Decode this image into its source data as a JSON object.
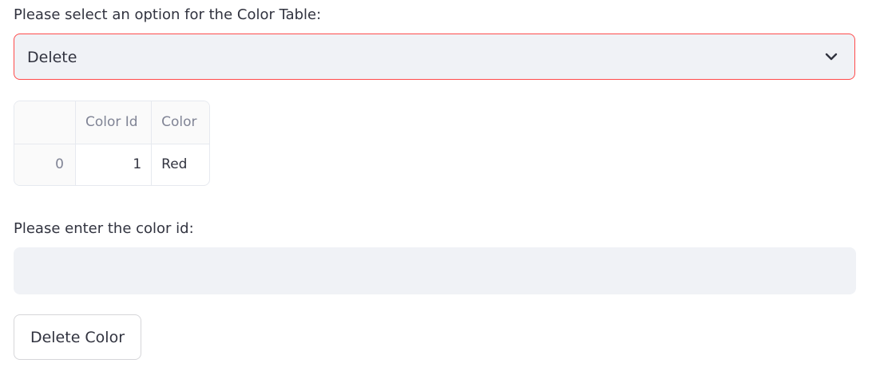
{
  "select": {
    "label": "Please select an option for the Color Table:",
    "value": "Delete",
    "icon": "chevron-down-icon",
    "focus_color": "#ff4b4b"
  },
  "table": {
    "columns": [
      "",
      "Color Id",
      "Color"
    ],
    "rows": [
      {
        "index": "0",
        "color_id": "1",
        "color": "Red"
      }
    ]
  },
  "id_input": {
    "label": "Please enter the color id:",
    "value": "",
    "placeholder": ""
  },
  "delete_button": {
    "label": "Delete Color"
  }
}
